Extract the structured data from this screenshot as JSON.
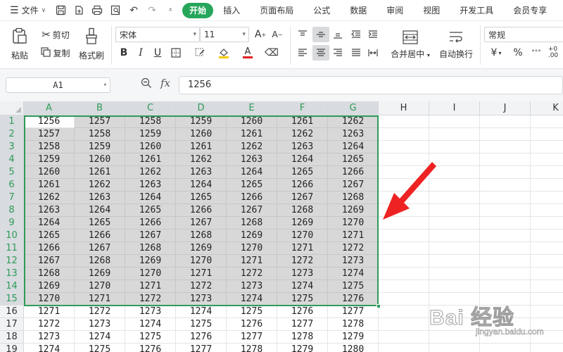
{
  "menubar": {
    "file_label": "文件",
    "tabs": [
      "开始",
      "插入",
      "页面布局",
      "公式",
      "数据",
      "审阅",
      "视图",
      "开发工具",
      "会员专享"
    ],
    "active_tab": "开始"
  },
  "ribbon": {
    "paste_label": "粘贴",
    "cut_label": "剪切",
    "copy_label": "复制",
    "format_painter_label": "格式刷",
    "font_name": "宋体",
    "font_size": "11",
    "merge_center_label": "合并居中",
    "wrap_text_label": "自动换行",
    "number_format": "常规",
    "currency_symbol": "¥",
    "percent_symbol": "%"
  },
  "formula_bar": {
    "name_box": "A1",
    "fx_label": "fx",
    "value": "1256"
  },
  "sheet": {
    "columns": [
      "A",
      "B",
      "C",
      "D",
      "E",
      "F",
      "G",
      "H",
      "I",
      "J",
      "K"
    ],
    "rows": [
      "1",
      "2",
      "3",
      "4",
      "5",
      "6",
      "7",
      "8",
      "9",
      "10",
      "11",
      "12",
      "13",
      "14",
      "15",
      "16",
      "17",
      "18",
      "19"
    ],
    "selected_range": "A1:G15",
    "cells": [
      [
        "1256",
        "1257",
        "1258",
        "1259",
        "1260",
        "1261",
        "1262"
      ],
      [
        "1257",
        "1258",
        "1259",
        "1260",
        "1261",
        "1262",
        "1263"
      ],
      [
        "1258",
        "1259",
        "1260",
        "1261",
        "1262",
        "1263",
        "1264"
      ],
      [
        "1259",
        "1260",
        "1261",
        "1262",
        "1263",
        "1264",
        "1265"
      ],
      [
        "1260",
        "1261",
        "1262",
        "1263",
        "1264",
        "1265",
        "1266"
      ],
      [
        "1261",
        "1262",
        "1263",
        "1264",
        "1265",
        "1266",
        "1267"
      ],
      [
        "1262",
        "1263",
        "1264",
        "1265",
        "1266",
        "1267",
        "1268"
      ],
      [
        "1263",
        "1264",
        "1265",
        "1266",
        "1267",
        "1268",
        "1269"
      ],
      [
        "1264",
        "1265",
        "1266",
        "1267",
        "1268",
        "1269",
        "1270"
      ],
      [
        "1265",
        "1266",
        "1267",
        "1268",
        "1269",
        "1270",
        "1271"
      ],
      [
        "1266",
        "1267",
        "1268",
        "1269",
        "1270",
        "1271",
        "1272"
      ],
      [
        "1267",
        "1268",
        "1269",
        "1270",
        "1271",
        "1272",
        "1273"
      ],
      [
        "1268",
        "1269",
        "1270",
        "1271",
        "1272",
        "1273",
        "1274"
      ],
      [
        "1269",
        "1270",
        "1271",
        "1272",
        "1273",
        "1274",
        "1275"
      ],
      [
        "1270",
        "1271",
        "1272",
        "1273",
        "1274",
        "1275",
        "1276"
      ],
      [
        "1271",
        "1272",
        "1273",
        "1274",
        "1275",
        "1276",
        "1277"
      ],
      [
        "1272",
        "1273",
        "1274",
        "1275",
        "1276",
        "1277",
        "1278"
      ],
      [
        "1273",
        "1274",
        "1275",
        "1276",
        "1277",
        "1278",
        "1279"
      ],
      [
        "1274",
        "1275",
        "1276",
        "1277",
        "1278",
        "1279",
        "1280"
      ]
    ]
  },
  "colors": {
    "accent_green": "#26a65b",
    "selection_border": "#2e9c5a",
    "annotation_arrow": "#ee2222"
  },
  "watermark": {
    "main_text": "Bai 经验",
    "sub_text": "jingyan.baidu.com"
  }
}
